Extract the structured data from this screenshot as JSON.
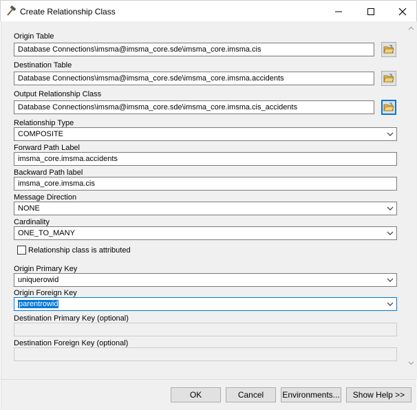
{
  "window": {
    "title": "Create Relationship Class",
    "app_icon": "hammer-icon",
    "controls": [
      "minimize-icon",
      "maximize-icon",
      "close-icon"
    ]
  },
  "form": {
    "origin_table": {
      "label": "Origin Table",
      "value": "Database Connections\\imsma@imsma_core.sde\\imsma_core.imsma.cis",
      "browse_icon": "open-folder-icon"
    },
    "destination_table": {
      "label": "Destination Table",
      "value": "Database Connections\\imsma@imsma_core.sde\\imsma_core.imsma.accidents",
      "browse_icon": "open-folder-icon"
    },
    "output_relationship_class": {
      "label": "Output Relationship Class",
      "value": "Database Connections\\imsma@imsma_core.sde\\imsma_core.imsma.cis_accidents",
      "browse_icon": "open-folder-icon"
    },
    "relationship_type": {
      "label": "Relationship Type",
      "value": "COMPOSITE"
    },
    "forward_path_label": {
      "label": "Forward Path Label",
      "value": "imsma_core.imsma.accidents"
    },
    "backward_path_label": {
      "label": "Backward Path label",
      "value": "imsma_core.imsma.cis"
    },
    "message_direction": {
      "label": "Message Direction",
      "value": "NONE"
    },
    "cardinality": {
      "label": "Cardinality",
      "value": "ONE_TO_MANY"
    },
    "attributed": {
      "label": "Relationship class is attributed",
      "checked": false
    },
    "origin_primary_key": {
      "label": "Origin Primary Key",
      "value": "uniquerowid"
    },
    "origin_foreign_key": {
      "label": "Origin Foreign Key",
      "value": "parentrowid"
    },
    "destination_primary_key": {
      "label": "Destination Primary Key (optional)",
      "value": ""
    },
    "destination_foreign_key": {
      "label": "Destination Foreign Key (optional)",
      "value": ""
    }
  },
  "buttons": {
    "ok": "OK",
    "cancel": "Cancel",
    "environments": "Environments...",
    "show_help": "Show Help >>"
  },
  "colors": {
    "accent": "#0078d7",
    "dialog_bg": "#f0f0f0",
    "folder_yellow": "#e8b84a"
  }
}
